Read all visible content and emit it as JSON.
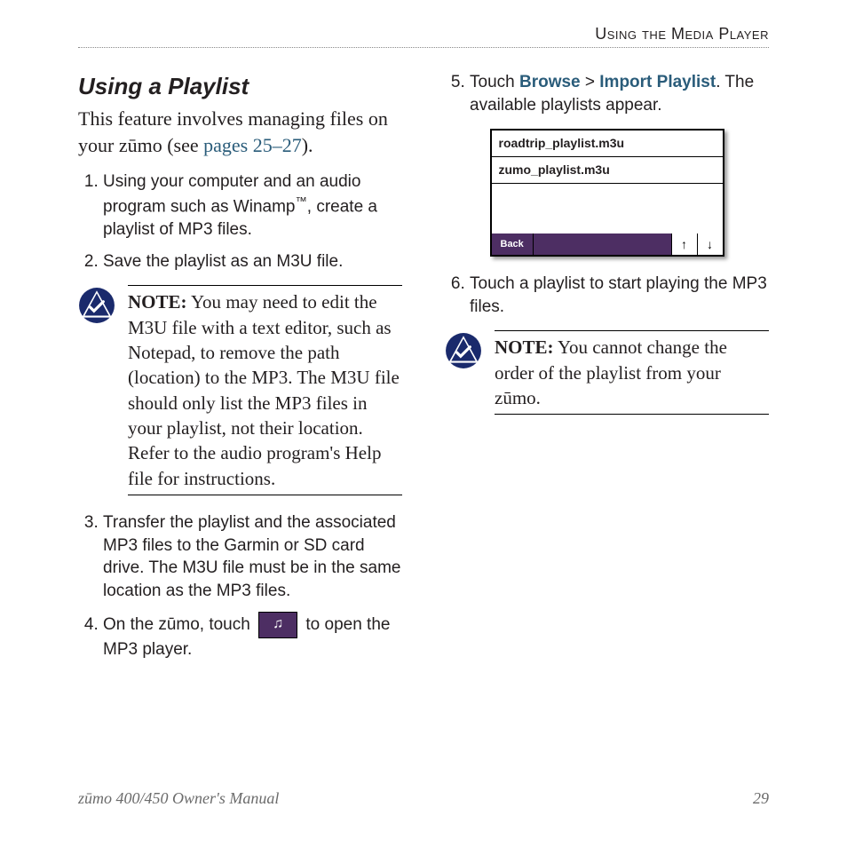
{
  "header": {
    "section": "Using the Media Player"
  },
  "left": {
    "h2": "Using a Playlist",
    "intro_a": "This feature involves managing files on your zūmo (see ",
    "intro_link": "pages 25–27",
    "intro_b": ").",
    "steps": {
      "s1_a": "Using your computer and an audio program such as Winamp",
      "s1_b": ", create a playlist of MP3 files.",
      "s2": "Save the playlist as an M3U file.",
      "s3": "Transfer the playlist and the associated MP3 files to the Garmin or SD card drive. The M3U file must be in the same location as the MP3 files.",
      "s4_a": "On the zūmo, touch ",
      "s4_b": " to open the MP3 player."
    },
    "note": {
      "label": "NOTE:",
      "text": " You may need to edit the M3U file with a text editor, such as Notepad, to remove the path (location) to the MP3. The M3U file should only list the MP3 files in your playlist, not their location. Refer to the audio program's Help file for instructions."
    }
  },
  "right": {
    "s5_a": "Touch ",
    "s5_browse": "Browse",
    "s5_sep": " > ",
    "s5_import": "Import Playlist",
    "s5_b": ". The available playlists appear.",
    "screenshot": {
      "row1": "roadtrip_playlist.m3u",
      "row2": "zumo_playlist.m3u",
      "back": "Back"
    },
    "s6": "Touch a playlist to start playing the MP3 files.",
    "note": {
      "label": "NOTE:",
      "text": " You cannot change the order of the playlist from your zūmo."
    }
  },
  "footer": {
    "left": "zūmo 400/450 Owner's Manual",
    "right": "29"
  }
}
